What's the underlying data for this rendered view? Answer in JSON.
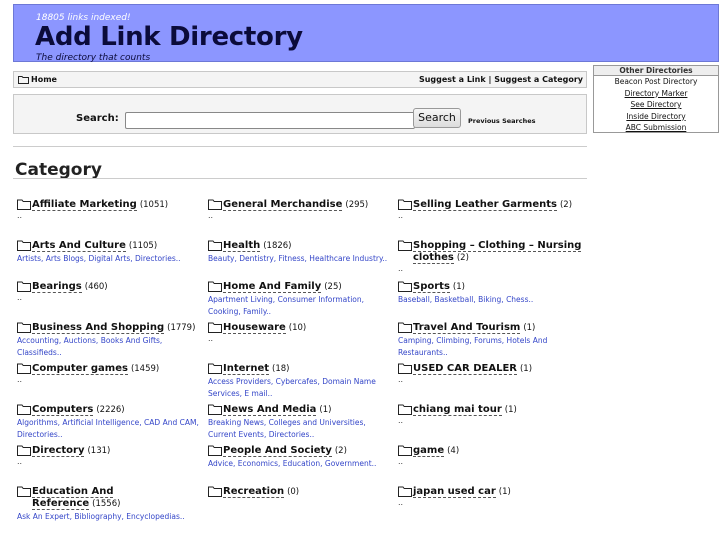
{
  "header": {
    "count": "18805 links indexed!",
    "title": "Add Link Directory",
    "tagline": "The directory that counts"
  },
  "nav": {
    "home": "Home",
    "suggest_link": "Suggest a Link",
    "separator": "|",
    "suggest_category": "Suggest a Category"
  },
  "other_directories": {
    "heading": "Other Directories",
    "items": [
      "Beacon Post Directory",
      "Directory Marker",
      "See Directory",
      "Inside Directory",
      "ABC Submission"
    ]
  },
  "search": {
    "label": "Search:",
    "value": "",
    "button": "Search",
    "previous": "Previous Searches"
  },
  "categories_heading": "Category",
  "columns": [
    [
      {
        "name": "Affiliate Marketing",
        "count": "(1051)",
        "subs": "",
        "tail": ".."
      },
      {
        "name": "Arts And Culture",
        "count": "(1105)",
        "subs": "Artists, Arts Blogs, Digital Arts, Directories..",
        "tail": ""
      },
      {
        "name": "Bearings",
        "count": "(460)",
        "subs": "",
        "tail": ".."
      },
      {
        "name": "Business And Shopping",
        "count": "(1779)",
        "subs": "Accounting, Auctions, Books And Gifts, Classifieds..",
        "tail": ""
      },
      {
        "name": "Computer games",
        "count": "(1459)",
        "subs": "",
        "tail": ".."
      },
      {
        "name": "Computers",
        "count": "(2226)",
        "subs": "Algorithms, Artificial Intelligence, CAD And CAM, Directories..",
        "tail": ""
      },
      {
        "name": "Directory",
        "count": "(131)",
        "subs": "",
        "tail": ".."
      },
      {
        "name": "Education And Reference",
        "count": "(1556)",
        "subs": "Ask An Expert, Bibliography, Encyclopedias..",
        "tail": ""
      }
    ],
    [
      {
        "name": "General Merchandise",
        "count": "(295)",
        "subs": "",
        "tail": ".."
      },
      {
        "name": "Health",
        "count": "(1826)",
        "subs": "Beauty, Dentistry, Fitness, Healthcare Industry..",
        "tail": ""
      },
      {
        "name": "Home And Family",
        "count": "(25)",
        "subs": "Apartment Living, Consumer Information, Cooking, Family..",
        "tail": ""
      },
      {
        "name": "Houseware",
        "count": "(10)",
        "subs": "",
        "tail": ".."
      },
      {
        "name": "Internet",
        "count": "(18)",
        "subs": "Access Providers, Cybercafes, Domain Name Services, E mail..",
        "tail": ""
      },
      {
        "name": "News And Media",
        "count": "(1)",
        "subs": "Breaking News, Colleges and Universities, Current Events, Directories..",
        "tail": ""
      },
      {
        "name": "People And Society",
        "count": "(2)",
        "subs": "Advice, Economics, Education, Government..",
        "tail": ""
      },
      {
        "name": "Recreation",
        "count": "(0)",
        "subs": "",
        "tail": ""
      }
    ],
    [
      {
        "name": "Selling Leather Garments",
        "count": "(2)",
        "subs": "",
        "tail": ".."
      },
      {
        "name": "Shopping – Clothing – Nursing clothes",
        "count": "(2)",
        "subs": "",
        "tail": ".."
      },
      {
        "name": "Sports",
        "count": "(1)",
        "subs": "Baseball, Basketball, Biking, Chess..",
        "tail": ""
      },
      {
        "name": "Travel And Tourism",
        "count": "(1)",
        "subs": "Camping, Climbing, Forums, Hotels And Restaurants..",
        "tail": ""
      },
      {
        "name": "USED CAR DEALER",
        "count": "(1)",
        "subs": "",
        "tail": ".."
      },
      {
        "name": "chiang mai tour",
        "count": "(1)",
        "subs": "",
        "tail": ".."
      },
      {
        "name": "game",
        "count": "(4)",
        "subs": "",
        "tail": ".."
      },
      {
        "name": "japan used car",
        "count": "(1)",
        "subs": "",
        "tail": ".."
      }
    ]
  ]
}
